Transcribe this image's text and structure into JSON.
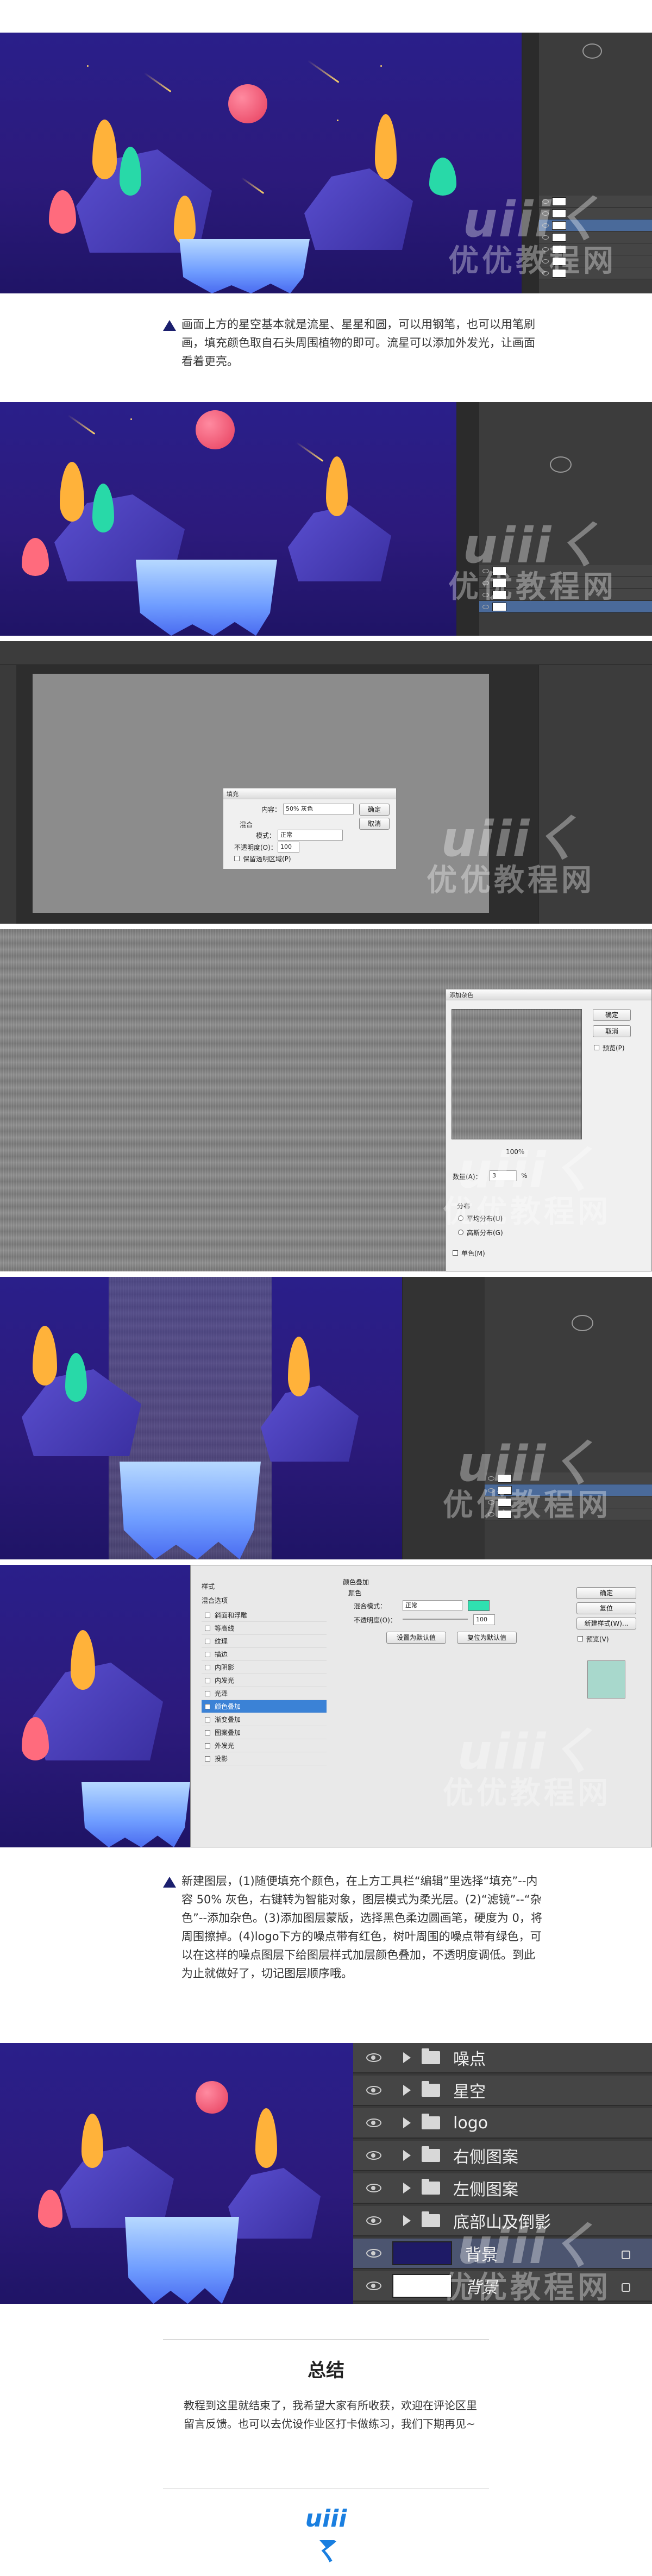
{
  "watermark": {
    "latin": "uiiiㄑ",
    "cn": "优优教程网"
  },
  "captions": {
    "c1": "画面上方的星空基本就是流星、星星和圆，可以用钢笔，也可以用笔刷画，填充颜色取自石头周围植物的即可。流星可以添加外发光，让画面看着更亮。",
    "c2": "新建图层，(1)随便填充个颜色，在上方工具栏“编辑”里选择“填充”--内容 50% 灰色，右键转为智能对象，图层模式为柔光层。(2)“滤镜”--“杂色”--添加杂色。(3)添加图层蒙版，选择黑色柔边圆画笔，硬度为 0，将周围擦掉。(4)logo下方的噪点带有红色，树叶周围的噪点带有绿色，可以在这样的噪点图层下给图层样式加层颜色叠加，不透明度调低。到此为止就做好了，切记图层顺序哦。"
  },
  "fill_dialog": {
    "title": "填充",
    "content_label": "内容：",
    "content_value": "50% 灰色",
    "blend_label": "混合",
    "mode_label": "模式：",
    "mode_value": "正常",
    "opacity_label": "不透明度(O)：",
    "opacity_value": "100",
    "preserve_label": "保留透明区域(P)",
    "ok": "确定",
    "cancel": "取消"
  },
  "noise_dialog": {
    "title": "添加杂色",
    "ok": "确定",
    "cancel": "取消",
    "preview": "预览(P)",
    "zoom": "100%",
    "amount_label": "数量(A)：",
    "amount_value": "3",
    "amount_unit": "%",
    "distribution": "分布",
    "uniform": "平均分布(U)",
    "gaussian": "高斯分布(G)",
    "mono": "单色(M)"
  },
  "style_dialog": {
    "styles_header": "样式",
    "blend_options": "混合选项",
    "items": [
      "斜面和浮雕",
      "等高线",
      "纹理",
      "描边",
      "内阴影",
      "内发光",
      "光泽",
      "颜色叠加",
      "渐变叠加",
      "图案叠加",
      "外发光",
      "投影"
    ],
    "section": "颜色叠加",
    "color_label": "颜色",
    "mode_label": "混合模式：",
    "mode_value": "正常",
    "opacity_label": "不透明度(O)：",
    "opacity_value": "100",
    "set_default": "设置为默认值",
    "reset_default": "复位为默认值",
    "ok": "确定",
    "cancel": "复位",
    "new_style": "新建样式(W)...",
    "preview": "预览(V)",
    "overlay_color": "#2fe0b0"
  },
  "layers_final": [
    {
      "name": "噪点",
      "type": "folder"
    },
    {
      "name": "星空",
      "type": "folder"
    },
    {
      "name": "logo",
      "type": "folder"
    },
    {
      "name": "右侧图案",
      "type": "folder"
    },
    {
      "name": "左侧图案",
      "type": "folder"
    },
    {
      "name": "底部山及倒影",
      "type": "folder"
    },
    {
      "name": "背景",
      "type": "fill",
      "color": "#1e1a66"
    },
    {
      "name": "背景",
      "type": "white",
      "color": "#ffffff"
    }
  ],
  "summary": {
    "title": "总结",
    "text": "教程到这里就结束了，我希望大家有所收获，欢迎在评论区里留言反馈。也可以去优设作业区打卡做练习，我们下期再见~"
  },
  "logo": "uiiiㄑ",
  "colors": {
    "accent": "#1a7fe0",
    "night": "#2a1f8a",
    "triangle": "#1b1f6e"
  }
}
